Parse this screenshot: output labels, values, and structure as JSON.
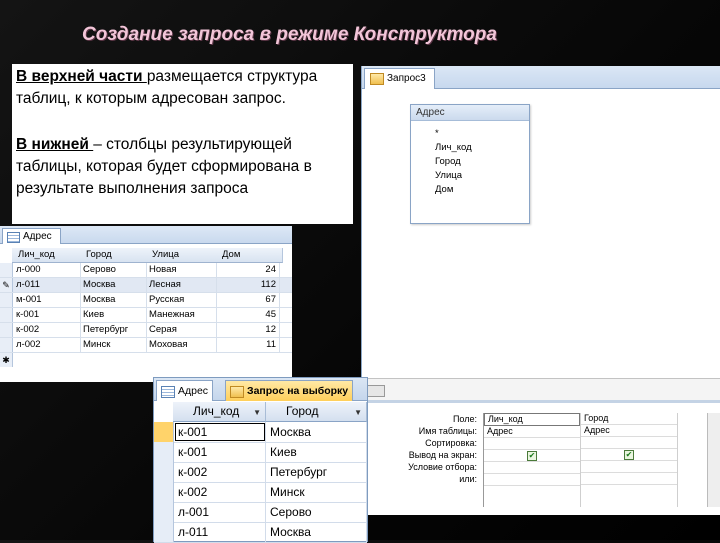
{
  "slide": {
    "title": "Создание запроса в режиме Конструктора",
    "para1": {
      "lead": "В верхней  части ",
      "text": "размещается структура таблиц, к которым адресован запрос."
    },
    "para2": {
      "lead": "В нижней ",
      "text": "– столбцы результирующей таблицы, которая  будет сформирована  в результате выполнения запроса"
    }
  },
  "designer": {
    "tab_label": "Запрос3",
    "field_list": {
      "title": "Адрес",
      "items": [
        "*",
        "Лич_код",
        "Город",
        "Улица",
        "Дом"
      ]
    },
    "grid_labels": [
      "Поле:",
      "Имя таблицы:",
      "Сортировка:",
      "Вывод на экран:",
      "Условие отбора:",
      "или:"
    ],
    "columns": [
      {
        "field": "Лич_код",
        "table": "Адрес",
        "show": true
      },
      {
        "field": "Город",
        "table": "Адрес",
        "show": true
      }
    ]
  },
  "table_sheet": {
    "tab_label": "Адрес",
    "headers": [
      "Лич_код",
      "Город",
      "Улица",
      "Дом"
    ],
    "rows": [
      {
        "sel": "",
        "cells": [
          "л-000",
          "Серово",
          "Новая",
          "24"
        ]
      },
      {
        "sel": "✎",
        "cells": [
          "л-011",
          "Москва",
          "Лесная",
          "112"
        ]
      },
      {
        "sel": "",
        "cells": [
          "м-001",
          "Москва",
          "Русская",
          "67"
        ]
      },
      {
        "sel": "",
        "cells": [
          "к-001",
          "Киев",
          "Манежная",
          "45"
        ]
      },
      {
        "sel": "",
        "cells": [
          "к-002",
          "Петербург",
          "Серая",
          "12"
        ]
      },
      {
        "sel": "",
        "cells": [
          "л-002",
          "Минск",
          "Моховая",
          "11"
        ]
      },
      {
        "sel": "✱",
        "cells": [
          "",
          "",
          "",
          ""
        ]
      }
    ]
  },
  "result_sheet": {
    "tabs": [
      "Адрес",
      "Запрос на выборку"
    ],
    "headers": [
      "Лич_код",
      "Город"
    ],
    "rows": [
      [
        "к-001",
        "Москва"
      ],
      [
        "к-001",
        "Киев"
      ],
      [
        "к-002",
        "Петербург"
      ],
      [
        "к-002",
        "Минск"
      ],
      [
        "л-001",
        "Серово"
      ],
      [
        "л-011",
        "Москва"
      ]
    ]
  },
  "colors": {
    "title": "#f2c5d8",
    "accent_tab": "#ffcf5a",
    "panel_border": "#8aa4c6"
  }
}
